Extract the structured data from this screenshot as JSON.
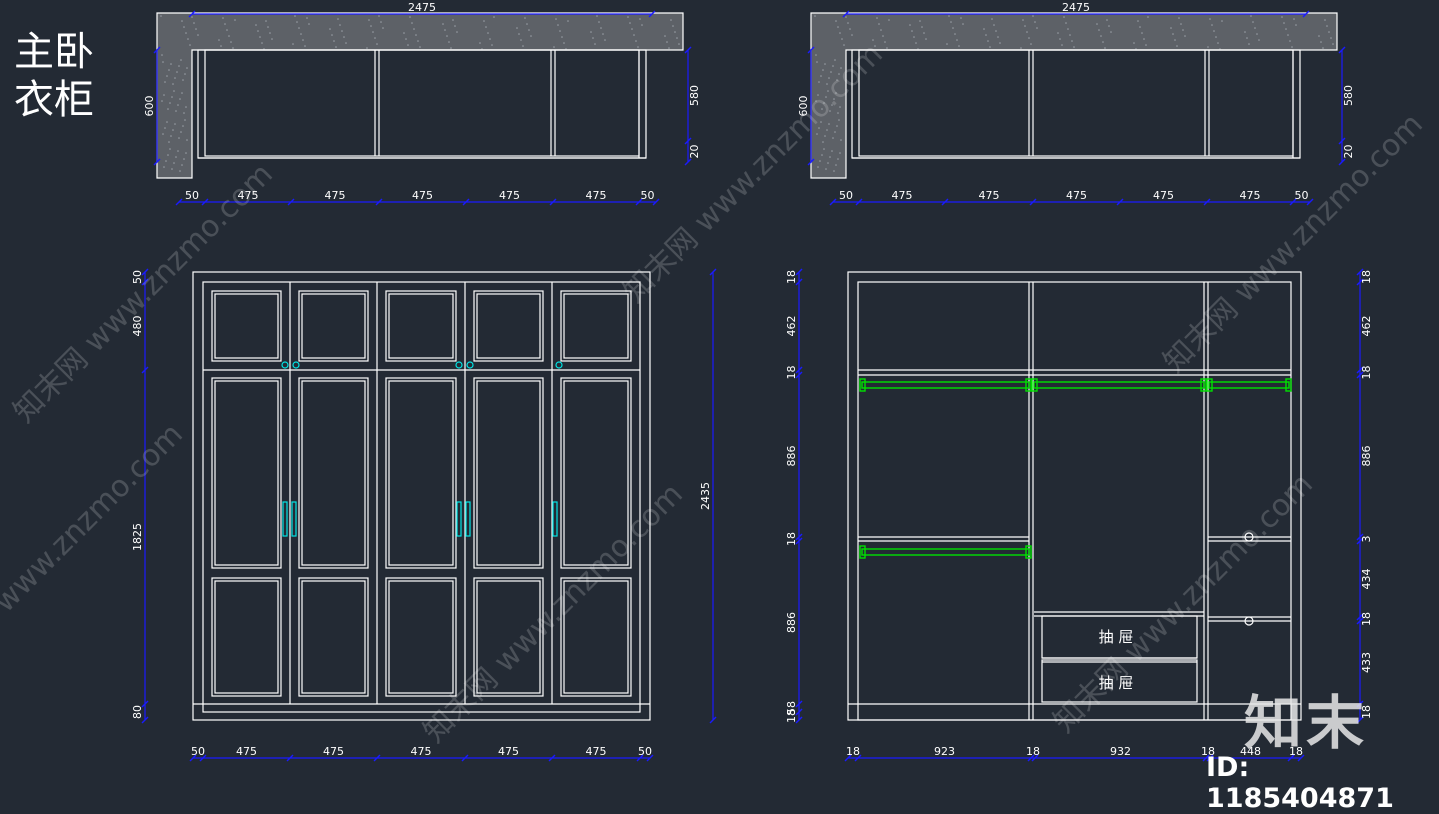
{
  "title_lines": [
    "主卧",
    "衣柜"
  ],
  "watermark": {
    "brand": "知末",
    "id": "ID: 1185404871",
    "site": "www.znzmo.com",
    "site_cn": "知末网"
  },
  "plan": {
    "width_label": "2475",
    "depth_label": "600",
    "right_dims": [
      "580",
      "20"
    ],
    "bottom_dims": [
      "50",
      "475",
      "475",
      "475",
      "475",
      "475",
      "50"
    ]
  },
  "front": {
    "height_label": "2435",
    "left_dims": [
      "50",
      "480",
      "1825",
      "80"
    ],
    "bottom_dims": [
      "50",
      "475",
      "475",
      "475",
      "475",
      "475",
      "50"
    ]
  },
  "interior": {
    "left_dims": [
      "18",
      "462",
      "18",
      "886",
      "18",
      "886",
      "58",
      "18"
    ],
    "right_dims": [
      "18",
      "462",
      "18",
      "886",
      "3",
      "434",
      "18",
      "433",
      "18"
    ],
    "bottom_dims": [
      "18",
      "923",
      "18",
      "932",
      "18",
      "448",
      "18"
    ],
    "drawer_labels": [
      "抽  屉",
      "抽  屉"
    ]
  },
  "colors": {
    "background": "#232a34",
    "lines": "#ffffff",
    "dimension": "#1a1aff",
    "rod": "#00e000",
    "handle": "#00e5e5",
    "stone": "#5d6167"
  }
}
